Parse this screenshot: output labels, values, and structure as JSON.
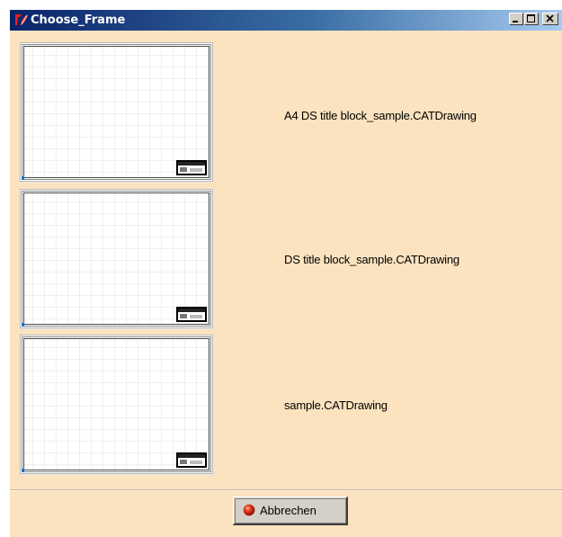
{
  "window": {
    "title": "Choose_Frame",
    "icon": "tk-feather-icon",
    "controls": [
      "minimize",
      "maximize",
      "close"
    ]
  },
  "frames": [
    {
      "label": "A4 DS title block_sample.CATDrawing",
      "thumbnail": "drawing-frame-thumbnail"
    },
    {
      "label": "DS title block_sample.CATDrawing",
      "thumbnail": "drawing-frame-thumbnail"
    },
    {
      "label": "sample.CATDrawing",
      "thumbnail": "drawing-frame-thumbnail"
    }
  ],
  "footer": {
    "cancel_label": "Abbrechen",
    "cancel_icon": "red-ball-icon"
  },
  "colors": {
    "window_background": "#fbe3c0",
    "titlebar_start": "#0a246a",
    "titlebar_end": "#a6caf0",
    "button_face": "#d4d0c8"
  }
}
